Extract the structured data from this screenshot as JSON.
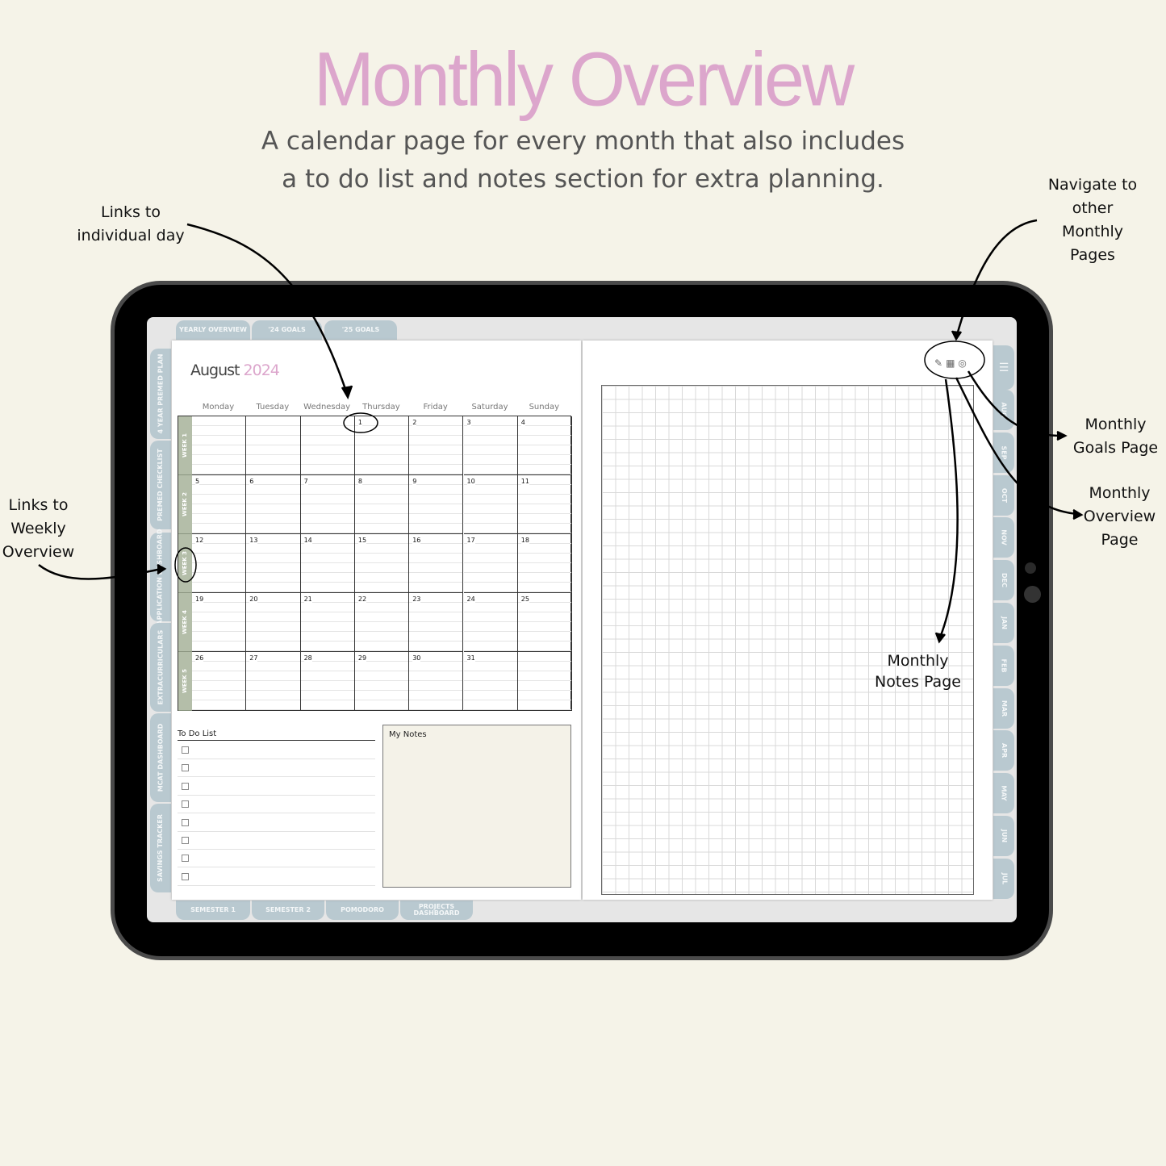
{
  "header": {
    "title": "Monthly Overview",
    "subtitle_line1": "A calendar page for every month that also includes",
    "subtitle_line2": "a to do list and notes section for extra planning."
  },
  "annotations": {
    "day_links": [
      "Links to",
      "individual day"
    ],
    "weekly": [
      "Links to",
      "Weekly",
      "Overview"
    ],
    "navigate": [
      "Navigate to",
      "other",
      "Monthly",
      "Pages"
    ],
    "goals": [
      "Monthly",
      "Goals Page"
    ],
    "overview": [
      "Monthly",
      "Overview",
      "Page"
    ],
    "notes": [
      "Monthly",
      "Notes Page"
    ]
  },
  "top_tabs": [
    "YEARLY OVERVIEW",
    "'24 GOALS",
    "'25 GOALS"
  ],
  "left_tabs": [
    "4 YEAR PREMED PLAN",
    "PREMED CHECKLIST",
    "APPLICATION DASHBOARD",
    "EXTRACURRICULARS",
    "MCAT DASHBOARD",
    "SAVINGS TRACKER"
  ],
  "bottom_tabs": [
    "SEMESTER 1",
    "SEMESTER 2",
    "POMODORO",
    "PROJECTS DASHBOARD"
  ],
  "right_tabs": [
    "AUG",
    "SEP",
    "OCT",
    "NOV",
    "DEC",
    "JAN",
    "FEB",
    "MAR",
    "APR",
    "MAY",
    "JUN",
    "JUL"
  ],
  "calendar": {
    "month": "August",
    "year": "2024",
    "year_color": "#dca6cc",
    "week_color": "#b4bea9",
    "day_names": [
      "Monday",
      "Tuesday",
      "Wednesday",
      "Thursday",
      "Friday",
      "Saturday",
      "Sunday"
    ],
    "weeks": [
      {
        "label": "WEEK 1",
        "days": [
          "",
          "",
          "",
          "1",
          "2",
          "3",
          "4"
        ]
      },
      {
        "label": "WEEK 2",
        "days": [
          "5",
          "6",
          "7",
          "8",
          "9",
          "10",
          "11"
        ]
      },
      {
        "label": "WEEK 3",
        "days": [
          "12",
          "13",
          "14",
          "15",
          "16",
          "17",
          "18"
        ]
      },
      {
        "label": "WEEK 4",
        "days": [
          "19",
          "20",
          "21",
          "22",
          "23",
          "24",
          "25"
        ]
      },
      {
        "label": "WEEK 5",
        "days": [
          "26",
          "27",
          "28",
          "29",
          "30",
          "31",
          ""
        ]
      }
    ]
  },
  "todo": {
    "title": "To Do List",
    "count": 8
  },
  "notes": {
    "title": "My Notes"
  },
  "icons": [
    "menu-icon",
    "notes-page-icon",
    "calendar-icon",
    "goal-target-icon"
  ],
  "colors": {
    "title": "#dca6cc",
    "tab": "#b9c9d0",
    "background": "#f5f3e8"
  }
}
